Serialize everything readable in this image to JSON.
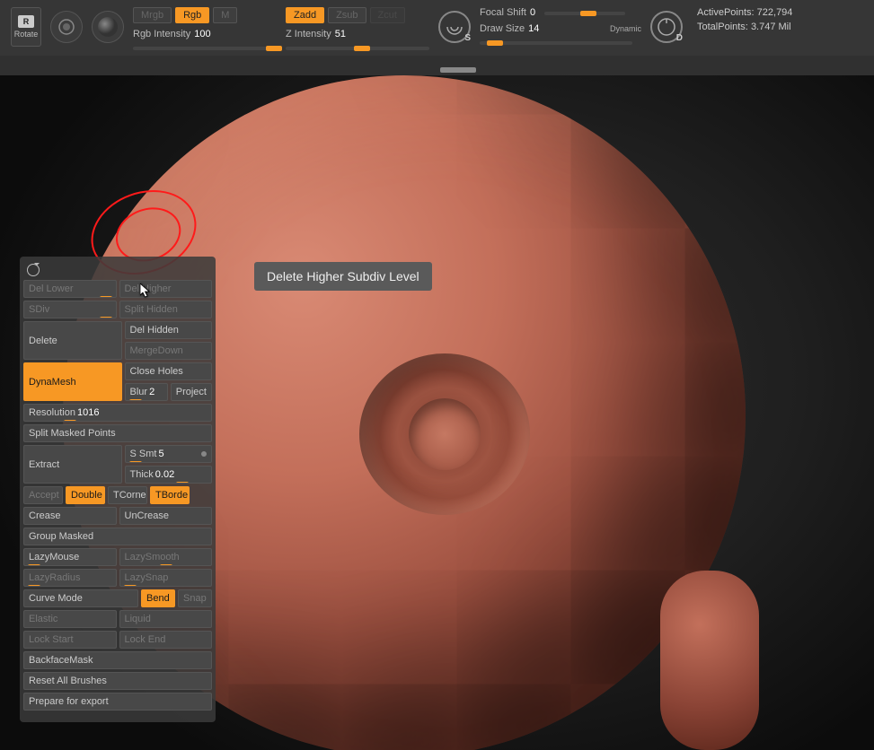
{
  "topbar": {
    "rotate_label": "Rotate",
    "rotate_badge": "R",
    "mrgb": "Mrgb",
    "rgb": "Rgb",
    "m": "M",
    "zadd": "Zadd",
    "zsub": "Zsub",
    "zcut": "Zcut",
    "rgb_intensity_label": "Rgb Intensity",
    "rgb_intensity_value": "100",
    "z_intensity_label": "Z Intensity",
    "z_intensity_value": "51",
    "focal_shift_label": "Focal Shift",
    "focal_shift_value": "0",
    "draw_size_label": "Draw Size",
    "draw_size_value": "14",
    "dynamic": "Dynamic",
    "ring_s": "S",
    "ring_d": "D"
  },
  "stats": {
    "active_label": "ActivePoints:",
    "active_value": "722,794",
    "total_label": "TotalPoints:",
    "total_value": "3.747 Mil"
  },
  "tooltip": "Delete Higher Subdiv Level",
  "panel": {
    "del_lower": "Del Lower",
    "del_higher": "Del Higher",
    "sdiv": "SDiv",
    "split_hidden": "Split Hidden",
    "delete": "Delete",
    "del_hidden": "Del Hidden",
    "merge_down": "MergeDown",
    "dynamesh": "DynaMesh",
    "close_holes": "Close Holes",
    "blur_label": "Blur",
    "blur_value": "2",
    "project": "Project",
    "resolution_label": "Resolution",
    "resolution_value": "1016",
    "split_masked": "Split Masked Points",
    "extract": "Extract",
    "s_smt_label": "S Smt",
    "s_smt_value": "5",
    "thick_label": "Thick",
    "thick_value": "0.02",
    "accept": "Accept",
    "double": "Double",
    "tcorner": "TCorne",
    "tborder": "TBorde",
    "crease": "Crease",
    "uncrease": "UnCrease",
    "group_masked": "Group Masked",
    "lazymouse": "LazyMouse",
    "lazysmooth": "LazySmooth",
    "lazyradius": "LazyRadius",
    "lazysnap": "LazySnap",
    "curve_mode": "Curve Mode",
    "bend": "Bend",
    "snap": "Snap",
    "elastic": "Elastic",
    "liquid": "Liquid",
    "lock_start": "Lock Start",
    "lock_end": "Lock End",
    "backface_mask": "BackfaceMask",
    "reset_brushes": "Reset All Brushes",
    "prepare_export": "Prepare for export"
  }
}
